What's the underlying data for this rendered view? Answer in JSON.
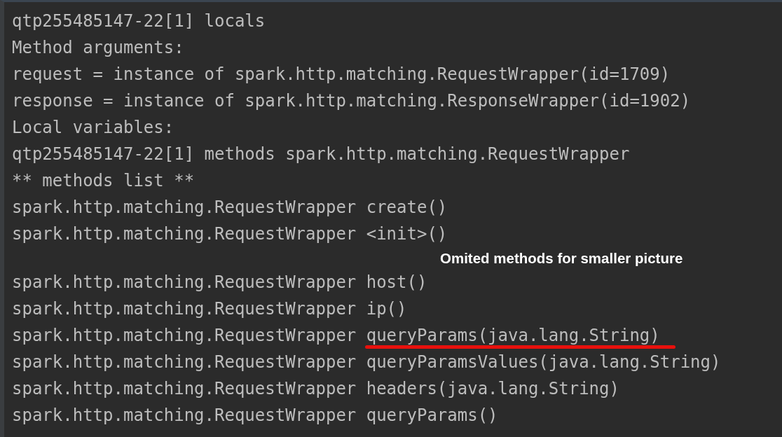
{
  "console": {
    "lines": [
      {
        "kind": "output",
        "text": "qtp255485147-22[1] locals",
        "underlined": false
      },
      {
        "kind": "output",
        "text": "Method arguments:",
        "underlined": false
      },
      {
        "kind": "output",
        "text": "request = instance of spark.http.matching.RequestWrapper(id=1709)",
        "underlined": false
      },
      {
        "kind": "output",
        "text": "response = instance of spark.http.matching.ResponseWrapper(id=1902)",
        "underlined": false
      },
      {
        "kind": "output",
        "text": "Local variables:",
        "underlined": false
      },
      {
        "kind": "output",
        "text": "qtp255485147-22[1] methods spark.http.matching.RequestWrapper",
        "underlined": false
      },
      {
        "kind": "output",
        "text": "** methods list **",
        "underlined": false
      },
      {
        "kind": "output",
        "text": "spark.http.matching.RequestWrapper create()",
        "underlined": false
      },
      {
        "kind": "output",
        "text": "spark.http.matching.RequestWrapper <init>()",
        "underlined": false
      },
      {
        "kind": "note",
        "text": "Omited methods for smaller picture"
      },
      {
        "kind": "output",
        "text": "spark.http.matching.RequestWrapper host()",
        "underlined": false
      },
      {
        "kind": "output",
        "text": "spark.http.matching.RequestWrapper ip()",
        "underlined": false
      },
      {
        "kind": "output",
        "text": "spark.http.matching.RequestWrapper queryParams(java.lang.String)",
        "underlined": true
      },
      {
        "kind": "output",
        "text": "spark.http.matching.RequestWrapper queryParamsValues(java.lang.String)",
        "underlined": false
      },
      {
        "kind": "output",
        "text": "spark.http.matching.RequestWrapper headers(java.lang.String)",
        "underlined": false
      },
      {
        "kind": "output",
        "text": "spark.http.matching.RequestWrapper queryParams()",
        "underlined": false
      }
    ]
  }
}
